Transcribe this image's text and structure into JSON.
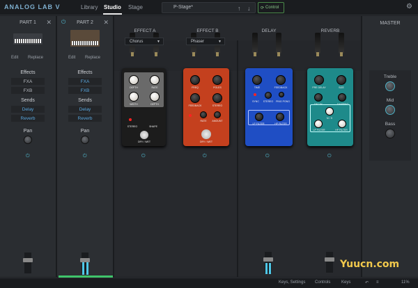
{
  "app": {
    "logo": "ANALOG LAB V"
  },
  "tabs": [
    {
      "label": "Library"
    },
    {
      "label": "Studio"
    },
    {
      "label": "Stage"
    }
  ],
  "preset": {
    "name": "P-Stage*",
    "up": "↑",
    "down": "↓"
  },
  "control": {
    "label": "Control"
  },
  "part1": {
    "title": "PART 1",
    "edit": "Edit",
    "replace": "Replace",
    "effects": "Effects",
    "fxa": "FXA",
    "fxb": "FXB",
    "sends": "Sends",
    "delay": "Delay",
    "reverb": "Reverb",
    "pan": "Pan"
  },
  "part2": {
    "title": "PART 2",
    "edit": "Edit",
    "replace": "Replace",
    "effects": "Effects",
    "fxa": "FXA",
    "fxb": "FXB",
    "sends": "Sends",
    "delay": "Delay",
    "reverb": "Reverb",
    "pan": "Pan"
  },
  "fx": {
    "a": {
      "title": "EFFECT A",
      "value": "Chorus"
    },
    "b": {
      "title": "EFFECT B",
      "value": "Phaser"
    },
    "delay": {
      "title": "DELAY"
    },
    "reverb": {
      "title": "REVERB"
    }
  },
  "pedals": {
    "chorus": [
      "DEPTH",
      "RATE",
      "WIDTH",
      "DEPTH",
      "STEREO",
      "SHAPE",
      "DRY / WET"
    ],
    "phaser": [
      "FREQ",
      "POLES",
      "FEEDBACK",
      "STEREO",
      "RATE",
      "AMOUNT",
      "DRY / WET"
    ],
    "delay": [
      "TIME",
      "FEEDBACK",
      "SYNC",
      "STEREO",
      "PING PONG",
      "LP FILTER",
      "HP FILTER"
    ],
    "reverb": [
      "PRE DELAY",
      "SIZE",
      "DECAY",
      "DAMPING",
      "M / S",
      "LP FILTER",
      "HP FILTER"
    ]
  },
  "master": {
    "title": "MASTER",
    "treble": "Treble",
    "mid": "Mid",
    "bass": "Bass"
  },
  "status": {
    "keys_settings": "Keys, Settings",
    "controls": "Controls",
    "keys": "Keys",
    "zoom": "11%"
  },
  "watermark": "Yuucn.com",
  "colors": {
    "accent": "#4fb3c8",
    "send": "#5aa8e0",
    "green": "#3fc46a"
  }
}
